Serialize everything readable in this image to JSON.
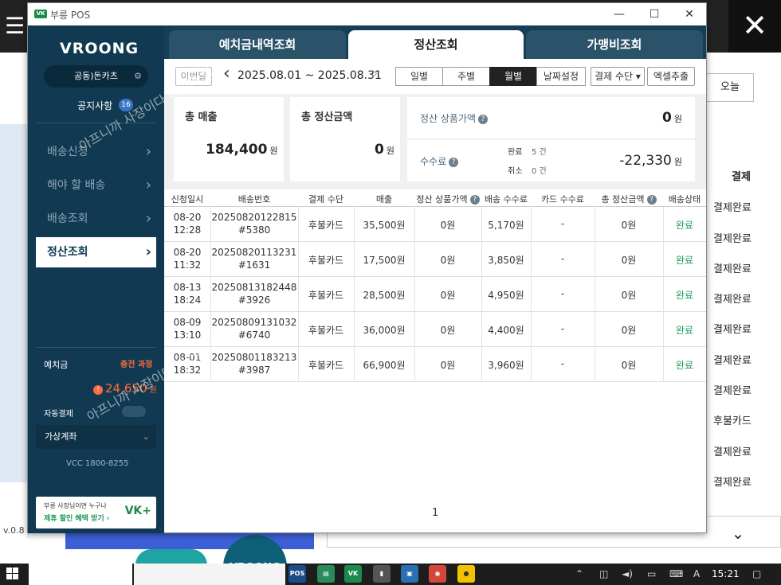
{
  "window": {
    "title": "부릉 POS",
    "controls": [
      "—",
      "☐",
      "✕"
    ]
  },
  "sidebar": {
    "brand": "VROONG",
    "store": "공동)돈카츠",
    "notice": {
      "label": "공지사항",
      "count": "16"
    },
    "menu": [
      {
        "label": "배송신청",
        "active": false
      },
      {
        "label": "해야 할 배송",
        "active": false
      },
      {
        "label": "배송조회",
        "active": false
      },
      {
        "label": "정산조회",
        "active": true
      }
    ],
    "deposit_label": "예치금",
    "charge_label": "충전 과정",
    "balance": "24,650",
    "balance_unit": "원",
    "autopay_label": "자동결제",
    "virtual_account_label": "가상계좌",
    "phone": "VCC  1800-8255",
    "promo": {
      "line1": "부릉 사장님이면 누구나",
      "line2": "제휴 할인 혜택 받기 ›",
      "logo": "VK+"
    }
  },
  "tabs": [
    {
      "label": "예치금내역조회",
      "active": false
    },
    {
      "label": "정산조회",
      "active": true
    },
    {
      "label": "가맹비조회",
      "active": false
    }
  ],
  "toolbar": {
    "prev_month": "이번달",
    "range": "2025.08.01 ~ 2025.08.31",
    "periods": [
      {
        "label": "일별",
        "selected": false
      },
      {
        "label": "주별",
        "selected": false
      },
      {
        "label": "월별",
        "selected": true
      },
      {
        "label": "날짜설정",
        "selected": false
      }
    ],
    "payment_filter": "결제 수단 ▾",
    "excel": "엑셀추출"
  },
  "summary": {
    "total_sales_label": "총 매출",
    "total_sales": "184,400",
    "total_settle_label": "총 정산금액",
    "total_settle": "0",
    "product_amount_label": "정산 상품가액",
    "product_amount": "0",
    "fee_label": "수수료",
    "fee_done_label": "완료",
    "fee_done_count": "5 건",
    "fee_cancel_label": "취소",
    "fee_cancel_count": "0 건",
    "fee_amount": "-22,330",
    "unit": "원"
  },
  "table": {
    "headers": [
      "신청일시",
      "배송번호",
      "결제 수단",
      "매출",
      "정산 상품가액",
      "배송 수수료",
      "카드 수수료",
      "총 정산금액",
      "배송상태"
    ],
    "rows": [
      {
        "date": "08-20",
        "time": "12:28",
        "order": "20250820122815",
        "order_sub": "#5380",
        "pay": "후불카드",
        "sales": "35,500원",
        "product": "0원",
        "fee": "5,170원",
        "card": "-",
        "total": "0원",
        "status": "완료"
      },
      {
        "date": "08-20",
        "time": "11:32",
        "order": "20250820113231",
        "order_sub": "#1631",
        "pay": "후불카드",
        "sales": "17,500원",
        "product": "0원",
        "fee": "3,850원",
        "card": "-",
        "total": "0원",
        "status": "완료"
      },
      {
        "date": "08-13",
        "time": "18:24",
        "order": "20250813182448",
        "order_sub": "#3926",
        "pay": "후불카드",
        "sales": "28,500원",
        "product": "0원",
        "fee": "4,950원",
        "card": "-",
        "total": "0원",
        "status": "완료"
      },
      {
        "date": "08-09",
        "time": "13:10",
        "order": "20250809131032",
        "order_sub": "#6740",
        "pay": "후불카드",
        "sales": "36,000원",
        "product": "0원",
        "fee": "4,400원",
        "card": "-",
        "total": "0원",
        "status": "완료"
      },
      {
        "date": "08-01",
        "time": "18:32",
        "order": "20250801183213",
        "order_sub": "#3987",
        "pay": "후불카드",
        "sales": "66,900원",
        "product": "0원",
        "fee": "3,960원",
        "card": "-",
        "total": "0원",
        "status": "완료"
      }
    ],
    "page": "1"
  },
  "watermark": "아프니까 사장이다 네이버 카페",
  "background": {
    "today_button": "오늘",
    "column_header": "결제",
    "statuses": [
      "결제완료",
      "결제완료",
      "결제완료",
      "결제완료",
      "결제완료",
      "결제완료",
      "결제완료",
      "후불카드",
      "결제완료",
      "결제완료"
    ],
    "version": "v.0.8",
    "circle_brand": "VROONG"
  },
  "taskbar": {
    "clock": "15:21",
    "ime": "A"
  },
  "colors": {
    "sidebar": "#113a52",
    "accent_orange": "#ff6b3d",
    "done_green": "#1b9a58"
  }
}
